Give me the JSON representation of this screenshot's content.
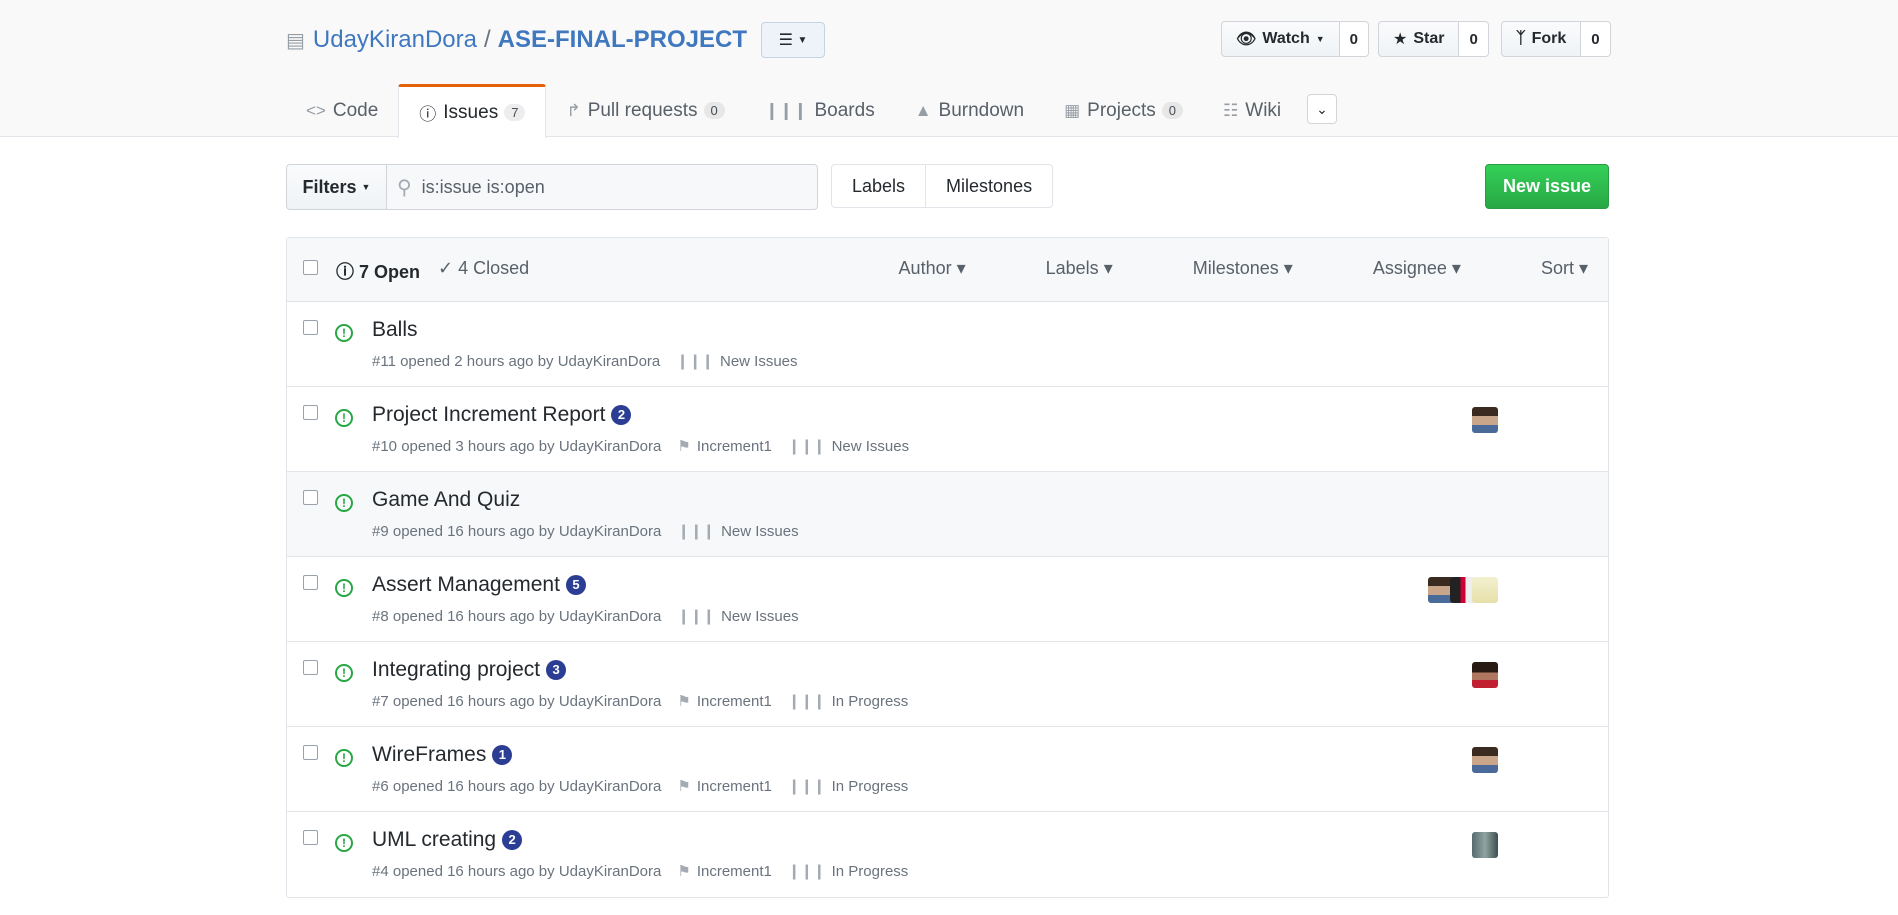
{
  "repo": {
    "owner": "UdayKiranDora",
    "separator": "/",
    "name": "ASE-FINAL-PROJECT"
  },
  "actions": [
    {
      "label": "Watch",
      "count": "0",
      "icon": "eye-icon"
    },
    {
      "label": "Star",
      "count": "0",
      "icon": "star-icon"
    },
    {
      "label": "Fork",
      "count": "0",
      "icon": "fork-icon"
    }
  ],
  "tabs": [
    {
      "label": "Code",
      "count": ""
    },
    {
      "label": "Issues",
      "count": "7"
    },
    {
      "label": "Pull requests",
      "count": "0"
    },
    {
      "label": "Boards",
      "count": ""
    },
    {
      "label": "Burndown",
      "count": ""
    },
    {
      "label": "Projects",
      "count": "0"
    },
    {
      "label": "Wiki",
      "count": ""
    }
  ],
  "toolbar": {
    "filters_label": "Filters",
    "search_value": "is:issue is:open",
    "labels_label": "Labels",
    "milestones_label": "Milestones",
    "new_issue_label": "New issue"
  },
  "list_header": {
    "open_label": "7 Open",
    "closed_label": "4 Closed",
    "menus": [
      "Author",
      "Labels",
      "Milestones",
      "Assignee",
      "Sort"
    ]
  },
  "issues": [
    {
      "title": "Balls",
      "comments": "",
      "meta": "#11 opened 2 hours ago by UdayKiranDora",
      "milestone": "",
      "project": "New Issues"
    },
    {
      "title": "Project Increment Report",
      "comments": "2",
      "meta": "#10 opened 3 hours ago by UdayKiranDora",
      "milestone": "Increment1",
      "project": "New Issues"
    },
    {
      "title": "Game And Quiz",
      "comments": "",
      "meta": "#9 opened 16 hours ago by UdayKiranDora",
      "milestone": "",
      "project": "New Issues"
    },
    {
      "title": "Assert Management",
      "comments": "5",
      "meta": "#8 opened 16 hours ago by UdayKiranDora",
      "milestone": "",
      "project": "New Issues"
    },
    {
      "title": "Integrating project",
      "comments": "3",
      "meta": "#7 opened 16 hours ago by UdayKiranDora",
      "milestone": "Increment1",
      "project": "In Progress"
    },
    {
      "title": "WireFrames",
      "comments": "1",
      "meta": "#6 opened 16 hours ago by UdayKiranDora",
      "milestone": "Increment1",
      "project": "In Progress"
    },
    {
      "title": "UML creating",
      "comments": "2",
      "meta": "#4 opened 16 hours ago by UdayKiranDora",
      "milestone": "Increment1",
      "project": "In Progress"
    }
  ],
  "colors": {
    "accent": "#4078c0",
    "open_green": "#28a745",
    "tab_active": "#e36209",
    "badge": "#2c3e94"
  }
}
